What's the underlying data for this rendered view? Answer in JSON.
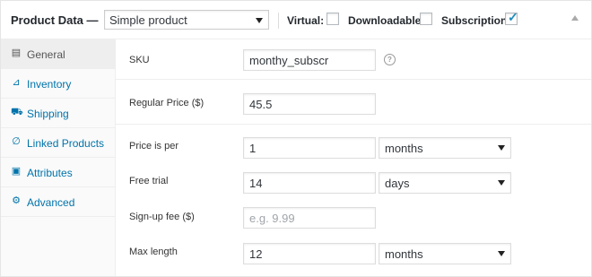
{
  "header": {
    "title": "Product Data —",
    "product_type": "Simple product",
    "options": [
      {
        "label": "Virtual:",
        "checked": false
      },
      {
        "label": "Downloadable:",
        "checked": false
      },
      {
        "label": "Subscription:",
        "checked": true
      }
    ]
  },
  "tabs": [
    {
      "label": "General",
      "icon": "general-icon",
      "active": true
    },
    {
      "label": "Inventory",
      "icon": "inventory-icon",
      "active": false
    },
    {
      "label": "Shipping",
      "icon": "shipping-icon",
      "active": false
    },
    {
      "label": "Linked Products",
      "icon": "link-icon",
      "active": false
    },
    {
      "label": "Attributes",
      "icon": "attributes-icon",
      "active": false
    },
    {
      "label": "Advanced",
      "icon": "gear-icon",
      "active": false
    }
  ],
  "fields": {
    "sku": {
      "label": "SKU",
      "value": "monthy_subscr"
    },
    "regular_price": {
      "label": "Regular Price ($)",
      "value": "45.5"
    },
    "price_is_per": {
      "label": "Price is per",
      "value": "1",
      "unit": "months"
    },
    "free_trial": {
      "label": "Free trial",
      "value": "14",
      "unit": "days"
    },
    "signup_fee": {
      "label": "Sign-up fee ($)",
      "placeholder": "e.g. 9.99"
    },
    "max_length": {
      "label": "Max length",
      "value": "12",
      "unit": "months"
    }
  },
  "colors": {
    "link": "#0073aa",
    "check": "#1e8cbe"
  }
}
